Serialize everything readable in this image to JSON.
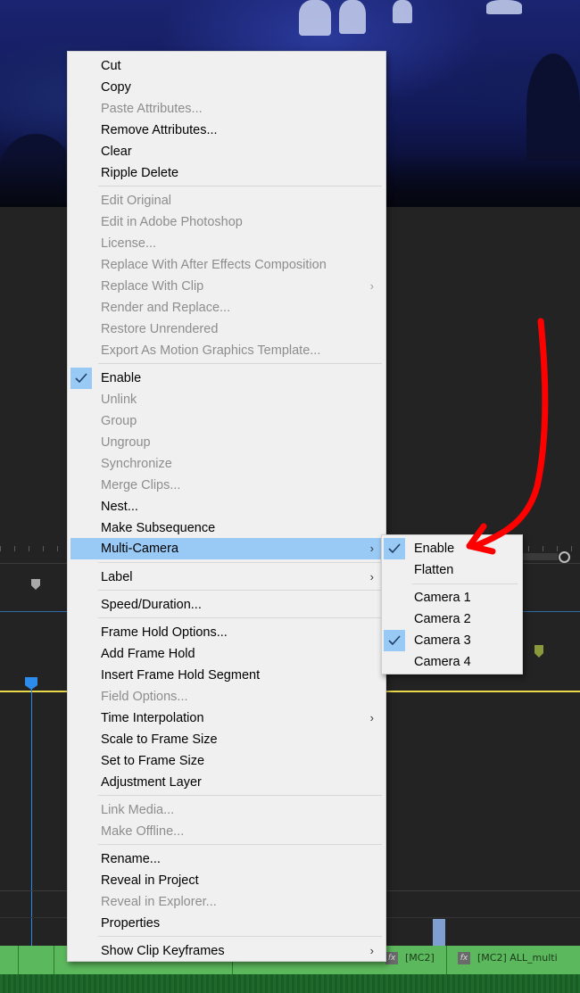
{
  "menu": {
    "items": [
      {
        "label": "Cut"
      },
      {
        "label": "Copy"
      },
      {
        "label": "Paste Attributes..."
      },
      {
        "label": "Remove Attributes..."
      },
      {
        "label": "Clear"
      },
      {
        "label": "Ripple Delete"
      },
      {
        "label": "Edit Original"
      },
      {
        "label": "Edit in Adobe Photoshop"
      },
      {
        "label": "License..."
      },
      {
        "label": "Replace With After Effects Composition"
      },
      {
        "label": "Replace With Clip"
      },
      {
        "label": "Render and Replace..."
      },
      {
        "label": "Restore Unrendered"
      },
      {
        "label": "Export As Motion Graphics Template..."
      },
      {
        "label": "Enable"
      },
      {
        "label": "Unlink"
      },
      {
        "label": "Group"
      },
      {
        "label": "Ungroup"
      },
      {
        "label": "Synchronize"
      },
      {
        "label": "Merge Clips..."
      },
      {
        "label": "Nest..."
      },
      {
        "label": "Make Subsequence"
      },
      {
        "label": "Multi-Camera"
      },
      {
        "label": "Label"
      },
      {
        "label": "Speed/Duration..."
      },
      {
        "label": "Frame Hold Options..."
      },
      {
        "label": "Add Frame Hold"
      },
      {
        "label": "Insert Frame Hold Segment"
      },
      {
        "label": "Field Options..."
      },
      {
        "label": "Time Interpolation"
      },
      {
        "label": "Scale to Frame Size"
      },
      {
        "label": "Set to Frame Size"
      },
      {
        "label": "Adjustment Layer"
      },
      {
        "label": "Link Media..."
      },
      {
        "label": "Make Offline..."
      },
      {
        "label": "Rename..."
      },
      {
        "label": "Reveal in Project"
      },
      {
        "label": "Reveal in Explorer..."
      },
      {
        "label": "Properties"
      },
      {
        "label": "Show Clip Keyframes"
      }
    ],
    "submenu_arrow": "›"
  },
  "submenu": {
    "items": [
      {
        "label": "Enable"
      },
      {
        "label": "Flatten"
      },
      {
        "label": "Camera 1"
      },
      {
        "label": "Camera 2"
      },
      {
        "label": "Camera 3"
      },
      {
        "label": "Camera 4"
      }
    ]
  },
  "timeline": {
    "clip_labels": [
      "[MC2]",
      "[MC2] ALL_multi"
    ],
    "fx_badge": "fx"
  },
  "colors": {
    "menu_bg": "#f0f0f0",
    "highlight": "#99c9f5",
    "annotation_arrow": "#ff0000",
    "clip_green": "#5cb85c",
    "playhead_blue": "#2d8ceb"
  }
}
